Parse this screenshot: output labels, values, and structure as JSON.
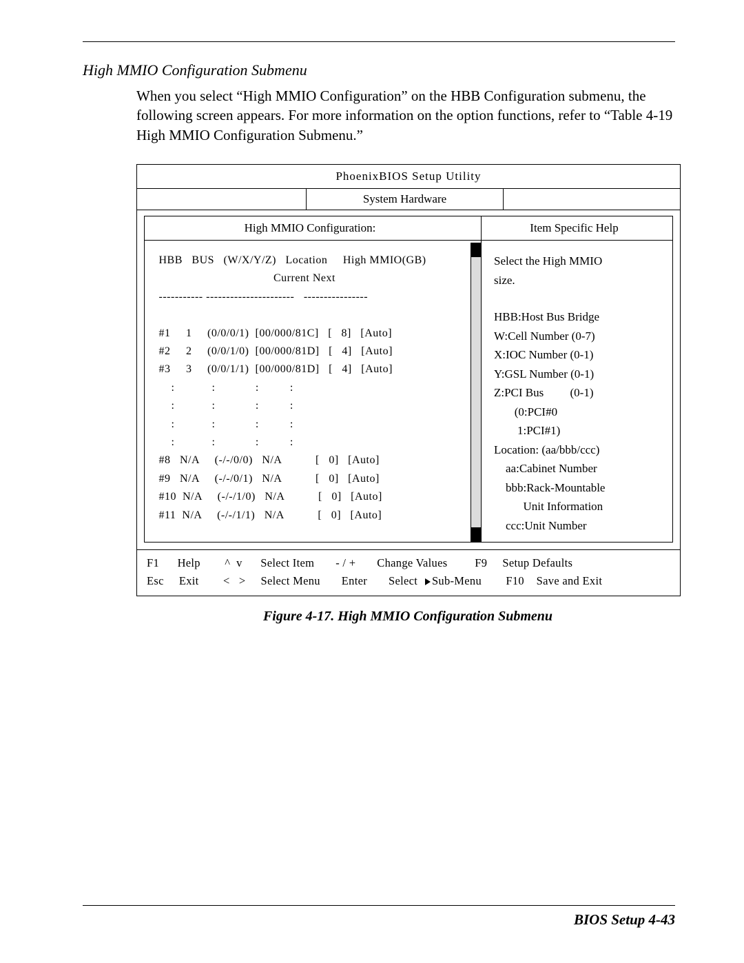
{
  "page": {
    "section_title": "High MMIO Configuration Submenu",
    "intro": "When you select “High MMIO Configuration” on the HBB Configuration submenu, the following screen appears.  For more information on the option functions, refer to “Table 4-19 High MMIO Configuration Submenu.”",
    "caption": "Figure 4-17.  High MMIO Configuration Submenu",
    "footer": "BIOS Setup    4-43"
  },
  "bios": {
    "title": "PhoenixBIOS    Setup    Utility",
    "tab": "System Hardware",
    "left_header": "High MMIO Configuration:",
    "right_header": "Item Specific Help",
    "columns": {
      "hbb": "HBB",
      "bus": "BUS",
      "wxyz": "(W/X/Y/Z)",
      "location": "Location",
      "mmio1": "High MMIO(GB)",
      "mmio2": "Current Next"
    },
    "dashes": {
      "c1": "------",
      "c2": "-----",
      "c3": "------------",
      "c4": "----------",
      "c5": "----------------"
    },
    "rows": [
      {
        "hbb": "#1",
        "bus": "1",
        "wxyz": "(0/0/0/1)",
        "loc": "[00/000/81C]",
        "cur": "8",
        "next": "[Auto]"
      },
      {
        "hbb": "#2",
        "bus": "2",
        "wxyz": "(0/0/1/0)",
        "loc": "[00/000/81D]",
        "cur": "4",
        "next": "[Auto]"
      },
      {
        "hbb": "#3",
        "bus": "3",
        "wxyz": "(0/0/1/1)",
        "loc": "[00/000/81D]",
        "cur": "4",
        "next": "[Auto]"
      }
    ],
    "dotrows_count": 4,
    "rows2": [
      {
        "hbb": "#8",
        "bus": "N/A",
        "wxyz": "(-/-/0/0)",
        "loc": "N/A",
        "cur": "0",
        "next": "[Auto]"
      },
      {
        "hbb": "#9",
        "bus": "N/A",
        "wxyz": "(-/-/0/1)",
        "loc": "N/A",
        "cur": "0",
        "next": "[Auto]"
      },
      {
        "hbb": "#10",
        "bus": "N/A",
        "wxyz": "(-/-/1/0)",
        "loc": "N/A",
        "cur": "0",
        "next": "[Auto]"
      },
      {
        "hbb": "#11",
        "bus": "N/A",
        "wxyz": "(-/-/1/1)",
        "loc": "N/A",
        "cur": "0",
        "next": "[Auto]"
      }
    ],
    "help": {
      "l1": "Select the High MMIO",
      "l2": "size.",
      "l3": "HBB:Host Bus Bridge",
      "l4": "W:Cell Number (0-7)",
      "l5": "X:IOC Number (0-1)",
      "l6": "Y:GSL Number (0-1)",
      "l7": "Z:PCI Bus         (0-1)",
      "l8": "       (0:PCI#0",
      "l9": "        1:PCI#1)",
      "l10": "Location: (aa/bbb/ccc)",
      "l11": "    aa:Cabinet Number",
      "l12": "    bbb:Rack-Mountable",
      "l13": "          Unit Information",
      "l14": "    ccc:Unit Number"
    },
    "footer": {
      "f1_key": "F1",
      "f1_lbl": "Help",
      "arrows_v": "^  v",
      "sel_item": "Select Item",
      "pm": "- / +",
      "chg": "Change Values",
      "f9_key": "F9",
      "f9_lbl": "Setup Defaults",
      "esc_key": "Esc",
      "esc_lbl": "Exit",
      "arrows_h": "<   >",
      "sel_menu": "Select Menu",
      "enter": "Enter",
      "submenu": "Select   Sub-Menu",
      "f10_key": "F10",
      "f10_lbl": "Save and Exit"
    }
  }
}
